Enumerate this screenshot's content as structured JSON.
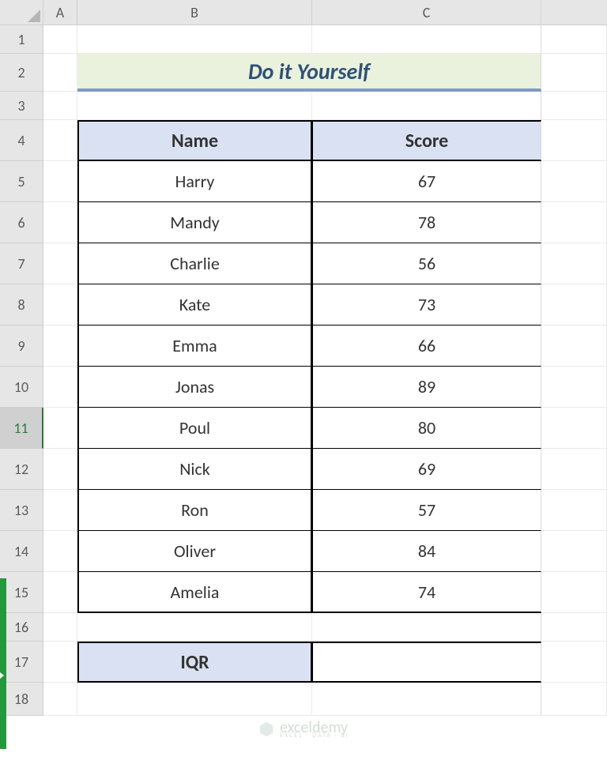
{
  "columns": {
    "A": "A",
    "B": "B",
    "C": "C"
  },
  "rows": [
    "1",
    "2",
    "3",
    "4",
    "5",
    "6",
    "7",
    "8",
    "9",
    "10",
    "11",
    "12",
    "13",
    "14",
    "15",
    "16",
    "17",
    "18"
  ],
  "title": "Do it Yourself",
  "table": {
    "headers": {
      "name": "Name",
      "score": "Score"
    },
    "rows": [
      {
        "name": "Harry",
        "score": "67"
      },
      {
        "name": "Mandy",
        "score": "78"
      },
      {
        "name": "Charlie",
        "score": "56"
      },
      {
        "name": "Kate",
        "score": "73"
      },
      {
        "name": "Emma",
        "score": "66"
      },
      {
        "name": "Jonas",
        "score": "89"
      },
      {
        "name": "Poul",
        "score": "80"
      },
      {
        "name": "Nick",
        "score": "69"
      },
      {
        "name": "Ron",
        "score": "57"
      },
      {
        "name": "Oliver",
        "score": "84"
      },
      {
        "name": "Amelia",
        "score": "74"
      }
    ]
  },
  "iqr": {
    "label": "IQR",
    "value": ""
  },
  "watermark": {
    "brand": "exceldemy",
    "tag": "EXCEL · DATA · BI"
  }
}
